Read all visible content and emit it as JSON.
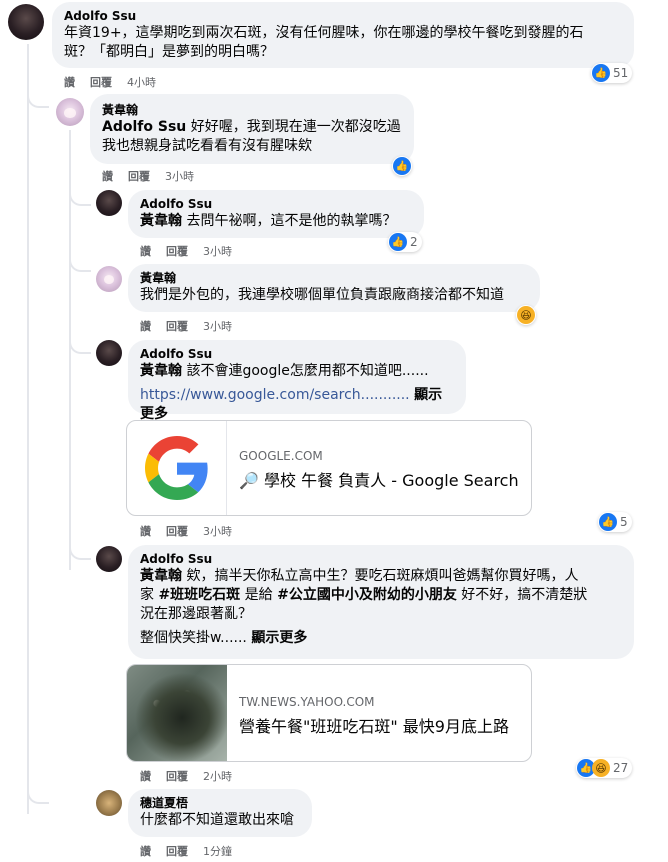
{
  "actions": {
    "like": "讚",
    "reply": "回覆"
  },
  "comments": [
    {
      "author": "Adolfo Ssu",
      "lines": [
        "年資19+，這學期吃到兩次石斑，沒有任何腥味，你在哪邊的學校午餐吃到發腥的石",
        "斑？「都明白」是夢到的明白嗎？"
      ],
      "time": "4小時",
      "reaction_count": "51"
    },
    {
      "author": "黃韋翰",
      "mention": "Adolfo Ssu",
      "line1": " 好好喔，我到現在連一次都沒吃過",
      "line2": "我也想親身試吃看看有沒有腥味欸",
      "time": "3小時"
    },
    {
      "author": "Adolfo Ssu",
      "mention": "黃韋翰",
      "line1": " 去問午祕啊，這不是他的執掌嗎？",
      "time": "3小時",
      "reaction_count": "2"
    },
    {
      "author": "黃韋翰",
      "line1": "我們是外包的，我連學校哪個單位負責跟廠商接洽都不知道",
      "time": "3小時"
    },
    {
      "author": "Adolfo Ssu",
      "mention": "黃韋翰",
      "line1": " 該不會連google怎麼用都不知道吧......",
      "link": "https://www.google.com/search...........",
      "more": "顯示更多",
      "time": "3小時",
      "reaction_count": "5",
      "card": {
        "domain": "GOOGLE.COM",
        "title": "🔎 學校 午餐 負責人 - Google Search"
      }
    },
    {
      "author": "Adolfo Ssu",
      "mention": "黃韋翰",
      "line1": " 欸，搞半天你私立高中生？要吃石斑麻煩叫爸媽幫你買好嗎，人",
      "line2_a": "家 ",
      "tag1": "#班班吃石斑",
      "line2_b": " 是給 ",
      "tag2": "#公立國中小及附幼的小朋友",
      "line2_c": " 好不好，搞不清楚狀",
      "line3": "況在那邊跟著亂？",
      "line4": "整個快笑掛w......",
      "more": "顯示更多",
      "time": "2小時",
      "reaction_count": "27",
      "card": {
        "domain": "TW.NEWS.YAHOO.COM",
        "title": "營養午餐\"班班吃石斑\" 最快9月底上路"
      }
    },
    {
      "author": "穗道夏梧",
      "line1": "什麼都不知道還敢出來嗆",
      "time": "1分鐘"
    }
  ],
  "colors": {
    "like": "#1877f2",
    "bubble": "#f0f2f5",
    "link": "#385898"
  }
}
